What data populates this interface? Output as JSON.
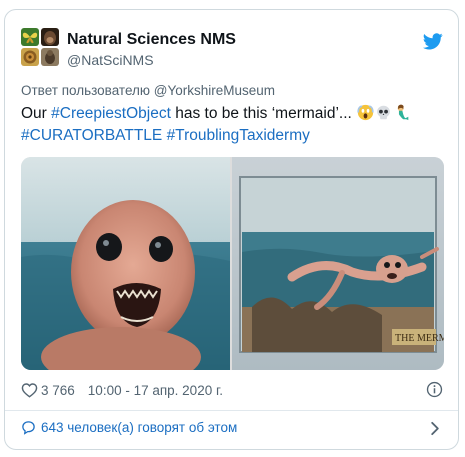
{
  "tweet": {
    "author_name": "Natural Sciences NMS",
    "author_handle": "@NatSciNMS",
    "reply_context": "Ответ пользователю @YorkshireMuseum",
    "text_parts": [
      {
        "text": "Our ",
        "type": "text"
      },
      {
        "text": "#CreepiestObject",
        "type": "hashtag"
      },
      {
        "text": " has to be this ‘mermaid’... ",
        "type": "text"
      }
    ],
    "text_line2": [
      {
        "text": "#CURATORBATTLE",
        "type": "hashtag"
      },
      {
        "text": " ",
        "type": "text"
      },
      {
        "text": "#TroublingTaxidermy",
        "type": "hashtag"
      }
    ],
    "emojis": [
      "screaming-face-icon",
      "skull-icon",
      "merperson-icon"
    ],
    "images": [
      {
        "name": "mermaid-face-closeup-image"
      },
      {
        "name": "mermaid-display-case-image",
        "caption": "THE MERMA"
      }
    ],
    "like_count": "3 766",
    "timestamp": "10:00 - 17 апр. 2020 г.",
    "conversation_link": "643 человек(а) говорят об этом"
  },
  "colors": {
    "link": "#1b6ec2",
    "twitter_blue": "#1d9bf0",
    "secondary_text": "#536471",
    "primary_text": "#0f1419"
  },
  "icons": [
    "twitter-bird-icon",
    "heart-icon",
    "info-icon",
    "speech-bubble-icon",
    "chevron-right-icon"
  ]
}
